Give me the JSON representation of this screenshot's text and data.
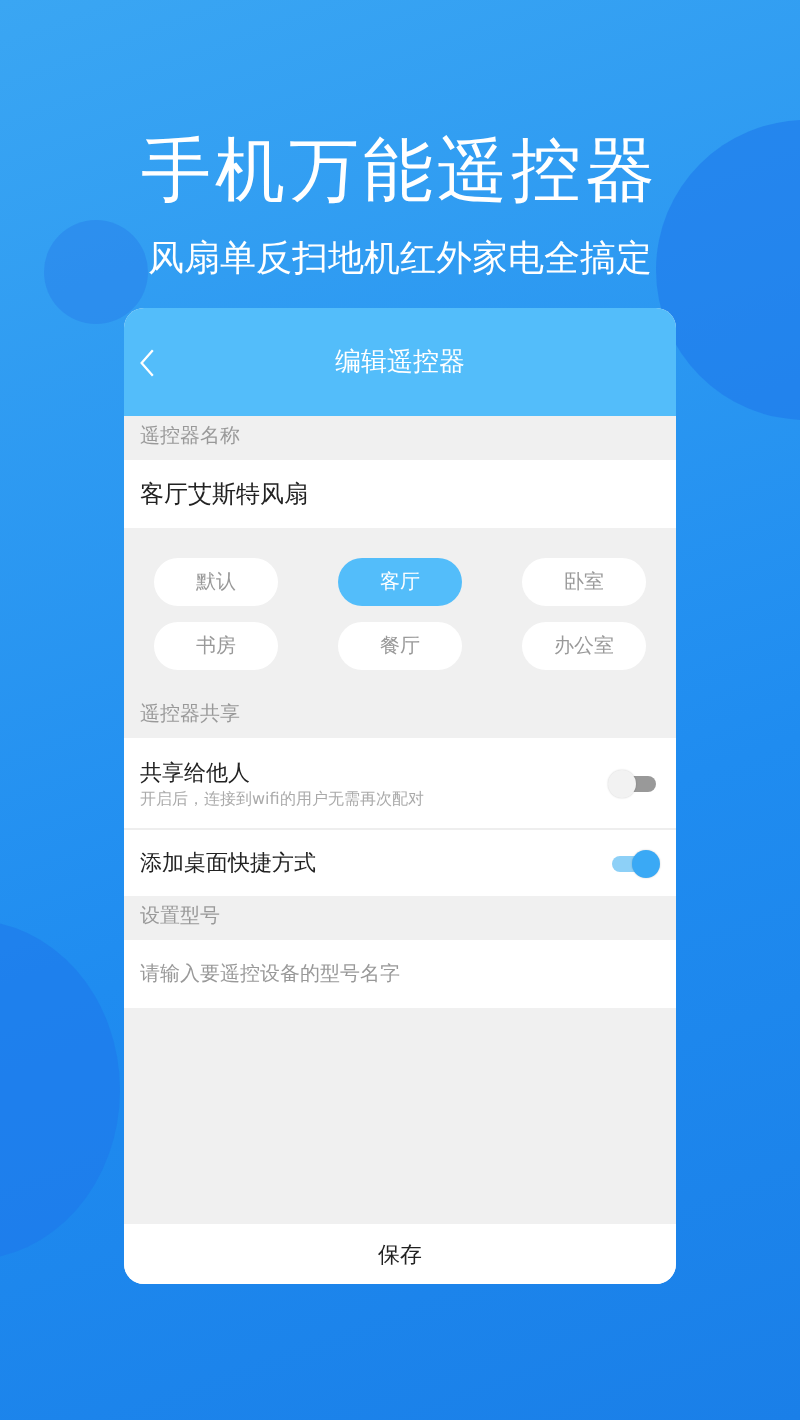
{
  "headline": "手机万能遥控器",
  "tagline": "风扇单反扫地机红外家电全搞定",
  "screen": {
    "title": "编辑遥控器",
    "name_section": {
      "label": "遥控器名称",
      "value": "客厅艾斯特风扇"
    },
    "rooms": [
      {
        "label": "默认",
        "selected": false
      },
      {
        "label": "客厅",
        "selected": true
      },
      {
        "label": "卧室",
        "selected": false
      },
      {
        "label": "书房",
        "selected": false
      },
      {
        "label": "餐厅",
        "selected": false
      },
      {
        "label": "办公室",
        "selected": false
      }
    ],
    "share_section": {
      "label": "遥控器共享"
    },
    "settings": [
      {
        "title": "共享给他人",
        "subtitle": "开启后，连接到wifi的用户无需再次配对",
        "on": false
      },
      {
        "title": "添加桌面快捷方式",
        "on": true
      }
    ],
    "model_section": {
      "label": "设置型号",
      "placeholder": "请输入要遥控设备的型号名字"
    },
    "save_button": "保存"
  }
}
